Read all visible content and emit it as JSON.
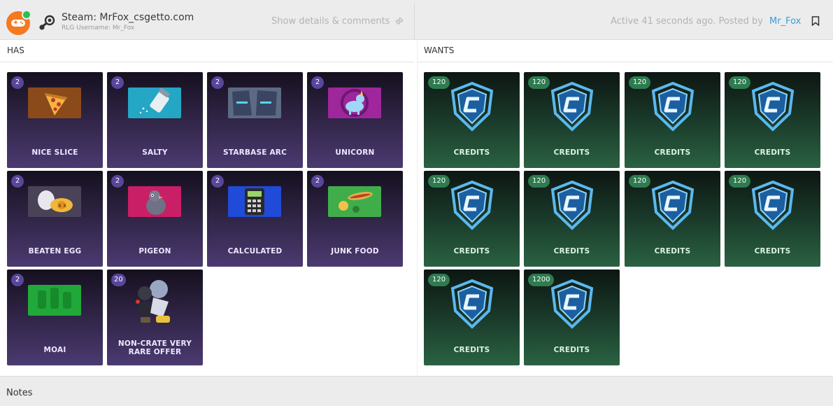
{
  "header": {
    "title": "Steam: MrFox_csgetto.com",
    "subtitle": "RLG Username: Mr_Fox",
    "show_details": "Show details & comments",
    "active_text": "Active 41 seconds ago. Posted by",
    "poster": "Mr_Fox"
  },
  "has": {
    "label": "HAS",
    "items": [
      {
        "qty": "2",
        "name": "NICE SLICE"
      },
      {
        "qty": "2",
        "name": "SALTY"
      },
      {
        "qty": "2",
        "name": "STARBASE ARC"
      },
      {
        "qty": "2",
        "name": "UNICORN"
      },
      {
        "qty": "2",
        "name": "BEATEN EGG"
      },
      {
        "qty": "2",
        "name": "PIGEON"
      },
      {
        "qty": "2",
        "name": "CALCULATED"
      },
      {
        "qty": "2",
        "name": "JUNK FOOD"
      },
      {
        "qty": "2",
        "name": "MOAI"
      },
      {
        "qty": "20",
        "name": "NON-CRATE VERY RARE OFFER"
      }
    ]
  },
  "wants": {
    "label": "WANTS",
    "items": [
      {
        "qty": "120",
        "name": "CREDITS"
      },
      {
        "qty": "120",
        "name": "CREDITS"
      },
      {
        "qty": "120",
        "name": "CREDITS"
      },
      {
        "qty": "120",
        "name": "CREDITS"
      },
      {
        "qty": "120",
        "name": "CREDITS"
      },
      {
        "qty": "120",
        "name": "CREDITS"
      },
      {
        "qty": "120",
        "name": "CREDITS"
      },
      {
        "qty": "120",
        "name": "CREDITS"
      },
      {
        "qty": "120",
        "name": "CREDITS"
      },
      {
        "qty": "1200",
        "name": "CREDITS"
      }
    ]
  },
  "notes": {
    "label": "Notes"
  },
  "colors": {
    "accent": "#3b9dde",
    "has_badge": "#58469b",
    "want_badge": "#2e7b4f",
    "avatar": "#f4791f"
  },
  "icons": {
    "avatar": "controller-icon",
    "platform": "steam-icon",
    "details": "link-icon",
    "bookmark": "bookmark-icon",
    "credits": "credits-shield-icon"
  }
}
